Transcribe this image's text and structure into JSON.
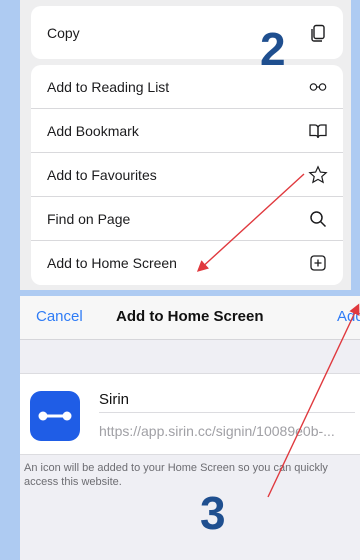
{
  "share_sheet": {
    "group1": [
      {
        "label": "Copy",
        "icon": "copy-icon"
      }
    ],
    "group2": [
      {
        "label": "Add to Reading List",
        "icon": "glasses-icon"
      },
      {
        "label": "Add Bookmark",
        "icon": "book-icon"
      },
      {
        "label": "Add to Favourites",
        "icon": "star-icon"
      },
      {
        "label": "Find on Page",
        "icon": "magnifier-icon"
      },
      {
        "label": "Add to Home Screen",
        "icon": "plus-square-icon"
      }
    ]
  },
  "steps": {
    "step2": "2",
    "step3": "3"
  },
  "dialog": {
    "cancel_label": "Cancel",
    "title": "Add to Home Screen",
    "add_label": "Add",
    "app_name": "Sirin",
    "url": "https://app.sirin.cc/signin/10089e0b-...",
    "help_text": "An icon will be added to your Home Screen so you can quickly access this website."
  },
  "colors": {
    "background": "#aecbf2",
    "accent": "#2f7cf6",
    "arrow": "#e0393e",
    "step_number": "#1f4f8f",
    "app_icon": "#1f5de6"
  }
}
